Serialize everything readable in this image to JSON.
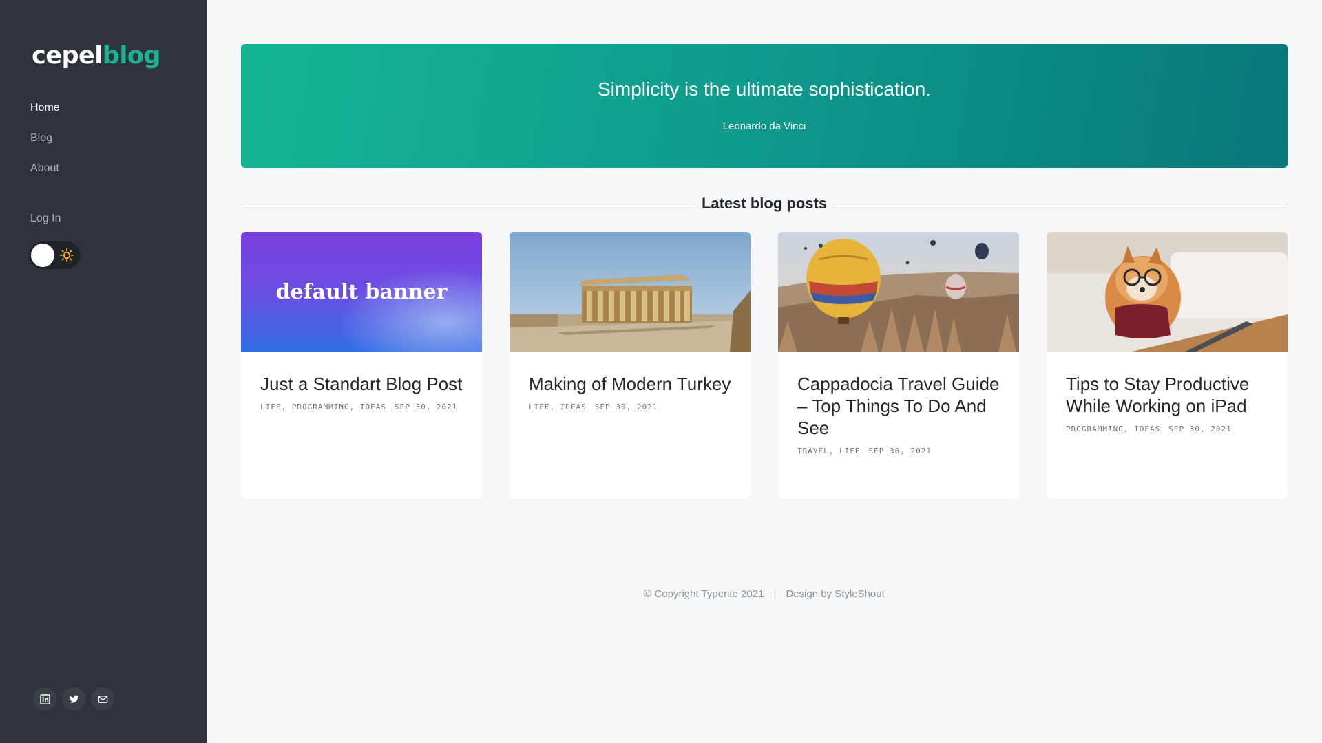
{
  "brand": {
    "part1": "cepel",
    "part2": "blog",
    "accent": "#1bb394"
  },
  "sidebar": {
    "nav": [
      {
        "label": "Home",
        "active": true
      },
      {
        "label": "Blog",
        "active": false
      },
      {
        "label": "About",
        "active": false
      }
    ],
    "login_label": "Log In",
    "theme_toggle": {
      "state": "light",
      "icon": "sun-icon"
    },
    "socials": [
      {
        "icon": "linkedin-icon"
      },
      {
        "icon": "twitter-icon"
      },
      {
        "icon": "mail-icon"
      }
    ]
  },
  "hero": {
    "quote": "Simplicity is the ultimate sophistication.",
    "author": "Leonardo da Vinci"
  },
  "section": {
    "title": "Latest blog posts"
  },
  "posts": [
    {
      "image": "default-banner",
      "banner_text": "default banner",
      "title": "Just a Standart Blog Post",
      "categories": "LIFE, PROGRAMMING, IDEAS",
      "date": "SEP 30, 2021"
    },
    {
      "image": "mausoleum-photo",
      "title": "Making of Modern Turkey",
      "categories": "LIFE, IDEAS",
      "date": "SEP 30, 2021"
    },
    {
      "image": "hot-air-balloons-photo",
      "title": "Cappadocia Travel Guide – Top Things To Do And See",
      "categories": "TRAVEL, LIFE",
      "date": "SEP 30, 2021"
    },
    {
      "image": "dog-with-glasses-photo",
      "title": "Tips to Stay Productive While Working on iPad",
      "categories": "PROGRAMMING, IDEAS",
      "date": "SEP 30, 2021"
    }
  ],
  "footer": {
    "copyright": "© Copyright Typerite 2021",
    "separator": "|",
    "design": "Design by StyleShout"
  }
}
